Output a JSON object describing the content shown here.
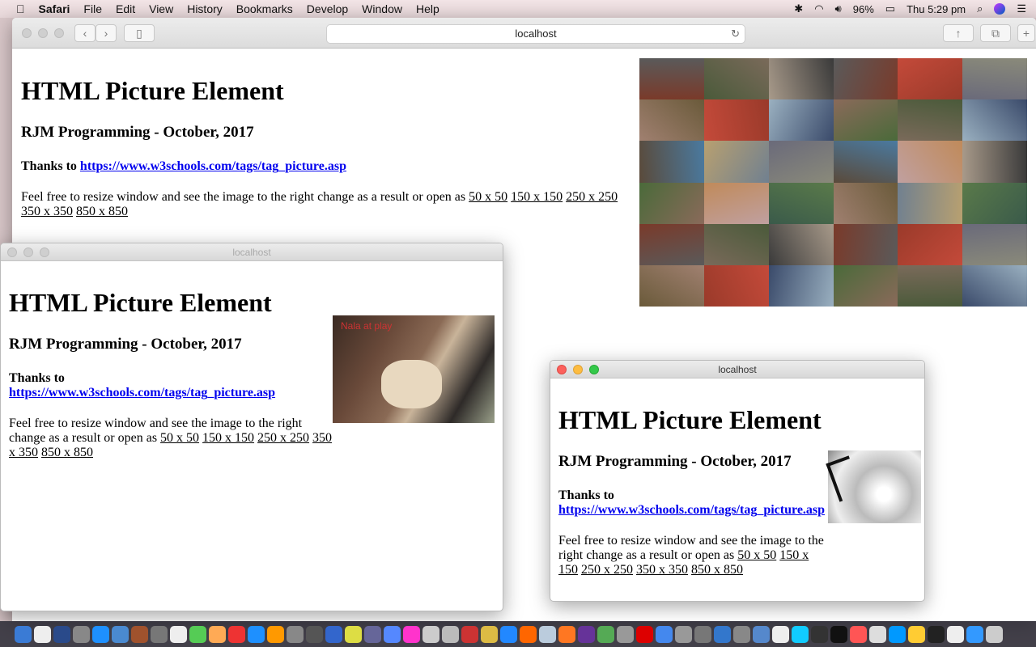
{
  "menubar": {
    "app": "Safari",
    "items": [
      "File",
      "Edit",
      "View",
      "History",
      "Bookmarks",
      "Develop",
      "Window",
      "Help"
    ],
    "battery": "96%",
    "clock": "Thu 5:29 pm"
  },
  "browser": {
    "url": "localhost"
  },
  "page": {
    "title": "HTML Picture Element",
    "subtitle": "RJM Programming - October, 2017",
    "thanks": "Thanks to",
    "link": "https://www.w3schools.com/tags/tag_picture.asp",
    "body": "Feel free to resize window and see the image to the right change as a result or open as",
    "sizes": [
      "50 x 50",
      "150 x 150",
      "250 x 250",
      "350 x 350",
      "850 x 850"
    ]
  },
  "popup1": {
    "title": "localhost",
    "image_caption": "Nala at play"
  },
  "popup2": {
    "title": "localhost"
  },
  "colors": {
    "link": "#0000ee",
    "close": "#fc605c",
    "minimize": "#fdbc40",
    "zoom": "#34c84a"
  }
}
